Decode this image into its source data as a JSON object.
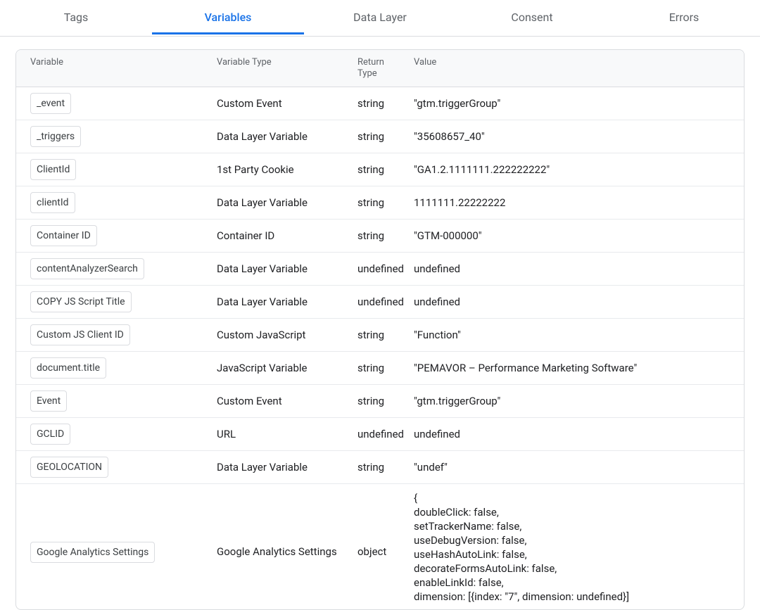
{
  "tabs": [
    {
      "label": "Tags",
      "active": false
    },
    {
      "label": "Variables",
      "active": true
    },
    {
      "label": "Data Layer",
      "active": false
    },
    {
      "label": "Consent",
      "active": false
    },
    {
      "label": "Errors",
      "active": false
    }
  ],
  "columns": {
    "variable": "Variable",
    "type": "Variable Type",
    "ret": "Return\nType",
    "value": "Value"
  },
  "rows": [
    {
      "name": "_event",
      "type": "Custom Event",
      "ret": "string",
      "value": "\"gtm.triggerGroup\""
    },
    {
      "name": "_triggers",
      "type": "Data Layer Variable",
      "ret": "string",
      "value": "\"35608657_40\""
    },
    {
      "name": "ClientId",
      "type": "1st Party Cookie",
      "ret": "string",
      "value": "\"GA1.2.1111111.222222222\""
    },
    {
      "name": "clientId",
      "type": "Data Layer Variable",
      "ret": "string",
      "value": "1111111.22222222"
    },
    {
      "name": "Container ID",
      "type": "Container ID",
      "ret": "string",
      "value": "\"GTM-000000\""
    },
    {
      "name": "contentAnalyzerSearch",
      "type": "Data Layer Variable",
      "ret": "undefined",
      "value": "undefined"
    },
    {
      "name": "COPY JS Script Title",
      "type": "Data Layer Variable",
      "ret": "undefined",
      "value": "undefined"
    },
    {
      "name": "Custom JS Client ID",
      "type": "Custom JavaScript",
      "ret": "string",
      "value": "\"Function\""
    },
    {
      "name": "document.title",
      "type": "JavaScript Variable",
      "ret": "string",
      "value": "\"PEMAVOR – Performance Marketing Software\""
    },
    {
      "name": "Event",
      "type": "Custom Event",
      "ret": "string",
      "value": "\"gtm.triggerGroup\""
    },
    {
      "name": "GCLID",
      "type": "URL",
      "ret": "undefined",
      "value": "undefined"
    },
    {
      "name": "GEOLOCATION",
      "type": "Data Layer Variable",
      "ret": "string",
      "value": "\"undef\""
    },
    {
      "name": "Google Analytics Settings",
      "type": "Google Analytics Settings",
      "ret": "object",
      "value": "{\n  doubleClick: false,\n  setTrackerName: false,\n  useDebugVersion: false,\n  useHashAutoLink: false,\n  decorateFormsAutoLink: false,\n  enableLinkId: false,\n  dimension: [{index: \"7\", dimension: undefined}]"
    }
  ]
}
